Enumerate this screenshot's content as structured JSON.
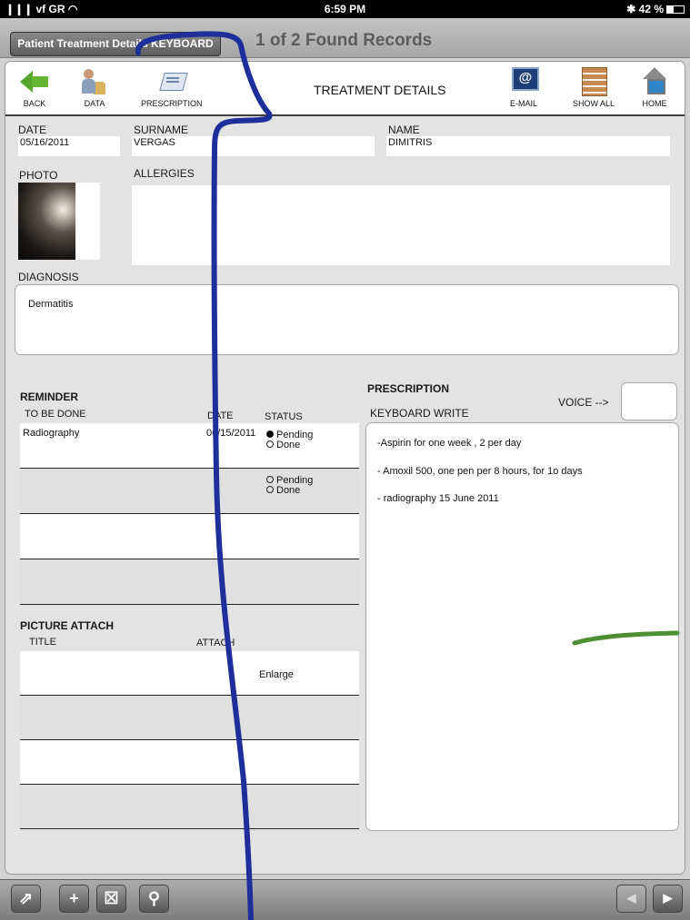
{
  "status_bar": {
    "carrier": "❙❙❙ vf GR ◠",
    "time": "6:59 PM",
    "battery": "✱ 42 %"
  },
  "header": {
    "layout_button": "Patient Treatment Details KEYBOARD",
    "record_count": "1 of 2 Found Records"
  },
  "toolbar": {
    "back": "BACK",
    "data": "DATA",
    "prescription": "PRESCRIPTION",
    "title": "TREATMENT DETAILS",
    "email": "E-MAIL",
    "show_all": "SHOW ALL",
    "home": "HOME"
  },
  "patient": {
    "date_label": "DATE",
    "date": "05/16/2011",
    "surname_label": "SURNAME",
    "surname": "VERGAS",
    "name_label": "NAME",
    "name": "DIMITRIS",
    "photo_label": "PHOTO",
    "allergies_label": "ALLERGIES",
    "allergies": "",
    "diagnosis_label": "DIAGNOSIS",
    "diagnosis": "Dermatitis"
  },
  "reminder": {
    "title": "REMINDER",
    "col_todo": "TO BE DONE",
    "col_date": "DATE",
    "col_status": "STATUS",
    "rows": [
      {
        "todo": "Radiography",
        "date": "06/15/2011",
        "pending": "Pending",
        "done": "Done",
        "status": "Pending"
      },
      {
        "todo": "",
        "date": "",
        "pending": "Pending",
        "done": "Done",
        "status": ""
      }
    ]
  },
  "picture_attach": {
    "title": "PICTURE ATTACH",
    "col_title": "TITLE",
    "col_attach": "ATTACH",
    "rows": [
      {
        "title": "",
        "action": "Enlarge"
      }
    ]
  },
  "prescription": {
    "title": "PRESCRIPTION",
    "voice_label": "VOICE -->",
    "keyboard_label": "KEYBOARD WRITE",
    "lines": [
      "-Aspirin for one week , 2 per day",
      "- Amoxil 500, one pen per 8 hours, for 1o days",
      "- radiography 15 June 2011"
    ]
  },
  "bottom_bar": {
    "share": "⇗",
    "add": "+",
    "delete": "☒",
    "search": "⚲",
    "prev": "◀",
    "next": "▶"
  }
}
